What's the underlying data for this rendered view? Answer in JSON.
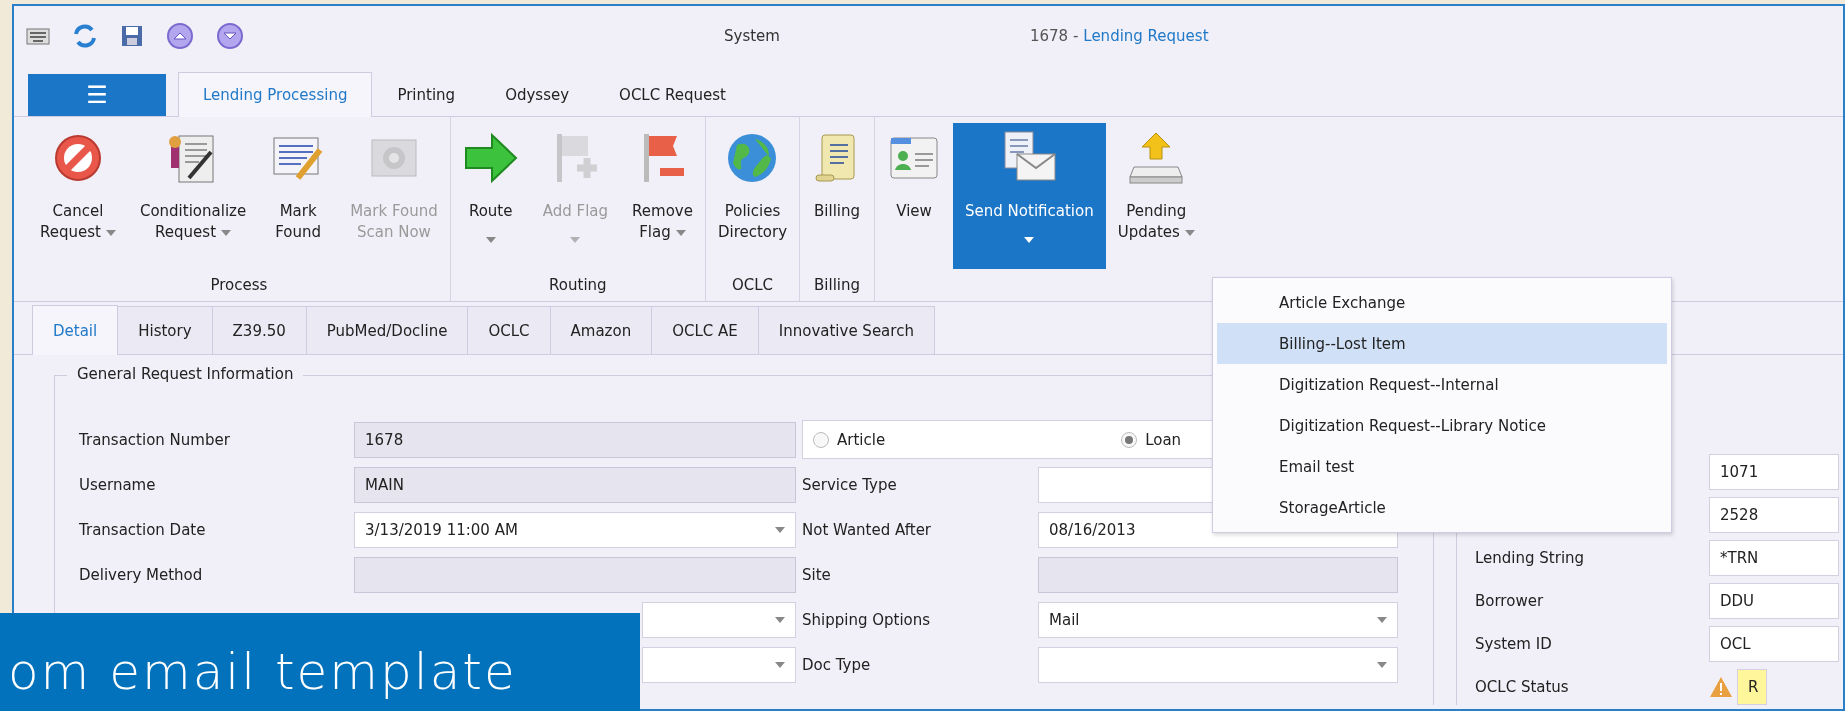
{
  "window": {
    "title": "System",
    "record_number": "1678 -",
    "record_type": "Lending Request"
  },
  "menu_button": {
    "label": "☰"
  },
  "ribbon_tabs": [
    {
      "label": "Lending Processing",
      "selected": true
    },
    {
      "label": "Printing",
      "selected": false
    },
    {
      "label": "Odyssey",
      "selected": false
    },
    {
      "label": "OCLC Request",
      "selected": false
    }
  ],
  "ribbon_groups": [
    {
      "label": "Process",
      "buttons": [
        {
          "kind": "cancel",
          "lines": [
            "Cancel",
            "Request"
          ],
          "dropdown": true,
          "disabled": false,
          "selected": false
        },
        {
          "kind": "certificate",
          "lines": [
            "Conditionalize",
            "Request"
          ],
          "dropdown": true,
          "disabled": false,
          "selected": false
        },
        {
          "kind": "list-edit",
          "lines": [
            "Mark",
            "Found"
          ],
          "dropdown": false,
          "disabled": false,
          "selected": false
        },
        {
          "kind": "scan",
          "lines": [
            "Mark Found",
            "Scan Now"
          ],
          "dropdown": false,
          "disabled": true,
          "selected": false
        }
      ]
    },
    {
      "label": "Routing",
      "buttons": [
        {
          "kind": "arrow",
          "lines": [
            "Route"
          ],
          "dropdown": true,
          "disabled": false,
          "selected": false
        },
        {
          "kind": "flag-add",
          "lines": [
            "Add Flag"
          ],
          "dropdown": true,
          "disabled": true,
          "selected": false
        },
        {
          "kind": "flag-remove",
          "lines": [
            "Remove",
            "Flag"
          ],
          "dropdown": true,
          "disabled": false,
          "selected": false
        }
      ]
    },
    {
      "label": "OCLC",
      "buttons": [
        {
          "kind": "globe",
          "lines": [
            "Policies",
            "Directory"
          ],
          "dropdown": false,
          "disabled": false,
          "selected": false
        }
      ]
    },
    {
      "label": "Billing",
      "buttons": [
        {
          "kind": "scroll",
          "lines": [
            "Billing"
          ],
          "dropdown": false,
          "disabled": false,
          "selected": false
        }
      ]
    },
    {
      "buttons": [
        {
          "kind": "contact",
          "lines": [
            "View"
          ],
          "dropdown": false,
          "disabled": false,
          "selected": false
        },
        {
          "kind": "mail",
          "lines": [
            "Send Notification"
          ],
          "dropdown": true,
          "disabled": false,
          "selected": true
        },
        {
          "kind": "upload",
          "lines": [
            "Pending",
            "Updates"
          ],
          "dropdown": true,
          "disabled": false,
          "selected": false
        }
      ]
    }
  ],
  "detail_tabs": [
    {
      "label": "Detail",
      "selected": true
    },
    {
      "label": "History",
      "selected": false
    },
    {
      "label": "Z39.50",
      "selected": false
    },
    {
      "label": "PubMed/Docline",
      "selected": false
    },
    {
      "label": "OCLC",
      "selected": false
    },
    {
      "label": "Amazon",
      "selected": false
    },
    {
      "label": "OCLC AE",
      "selected": false
    },
    {
      "label": "Innovative Search",
      "selected": false
    }
  ],
  "form": {
    "title": "General Request Information",
    "request_type": [
      {
        "label": "Article",
        "selected": false
      },
      {
        "label": "Loan",
        "selected": true
      }
    ],
    "left_rows": [
      {
        "label": "Transaction Number",
        "value": "1678",
        "readonly": true,
        "dropdown": false
      },
      {
        "label": "Username",
        "value": "MAIN",
        "readonly": true,
        "dropdown": false
      },
      {
        "label": "Transaction Date",
        "value": "3/13/2019 11:00 AM",
        "readonly": false,
        "dropdown": true
      },
      {
        "label": "Delivery Method",
        "readonly": true,
        "dropdown": false
      },
      {
        "readonly": false,
        "dropdown": true
      },
      {
        "readonly": false,
        "dropdown": true
      }
    ],
    "middle_rows": [
      {
        "label": "Service Type",
        "readonly": false
      },
      {
        "label": "Not Wanted After",
        "value": "08/16/2013",
        "readonly": false
      },
      {
        "label": "Site",
        "readonly": true,
        "dropdown": false
      },
      {
        "label": "Shipping Options",
        "value": "Mail",
        "readonly": false,
        "dropdown": true
      },
      {
        "label": "Doc Type",
        "readonly": false,
        "dropdown": true
      }
    ]
  },
  "right_panel": {
    "rows": [
      {
        "value": "1071"
      },
      {
        "value": "2528"
      },
      {
        "label": "Lending String",
        "value": "*TRN"
      },
      {
        "label": "Borrower",
        "value": "DDU"
      },
      {
        "label": "System ID",
        "value": "OCL"
      },
      {
        "label": "OCLC Status",
        "value": "R",
        "kind": "warning"
      }
    ]
  },
  "notification_menu": {
    "items": [
      {
        "label": "Article Exchange",
        "selected": false
      },
      {
        "label": "Billing--Lost Item",
        "selected": true
      },
      {
        "label": "Digitization Request--Internal",
        "selected": false
      },
      {
        "label": "Digitization Request--Library Notice",
        "selected": false
      },
      {
        "label": "Email test",
        "selected": false
      },
      {
        "label": "StorageArticle",
        "selected": false
      }
    ]
  },
  "banner": {
    "text": "om email template"
  }
}
